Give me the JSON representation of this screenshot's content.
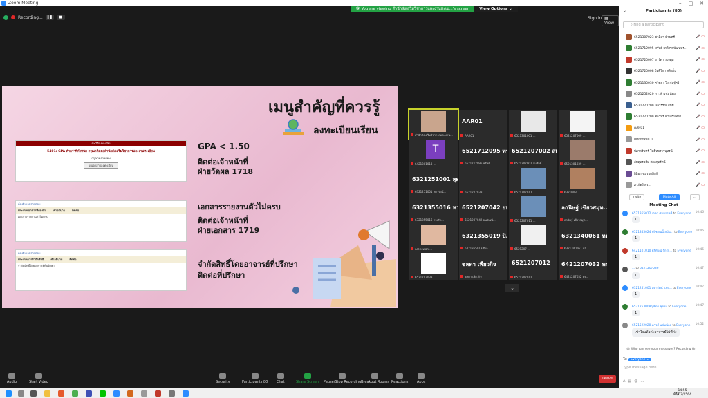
{
  "window": {
    "title": "Zoom Meeting"
  },
  "banner": {
    "message": "You are viewing สำนักส่งเสริมวิชาการและงานทะเบ...'s screen",
    "options": "View Options"
  },
  "recording": {
    "label": "Recording..."
  },
  "topright": {
    "signin": "Sign in",
    "view": "View"
  },
  "slide": {
    "title": "เมนูสำคัญที่ควรรู้",
    "subtitle": "ลงทะเบียนเรียน",
    "doc1": {
      "header": "ประวัติลงทะเบียน",
      "red": "5401: GPA ต่ำกว่าที่กำหนด กรุณาติดต่อสำนักส่งเสริมวิชาการและงานทะเบียน",
      "sub": "กรุณาตรวจสอบ",
      "btn": "ขอเอกสารลงทะเบียน"
    },
    "doc2": {
      "link": "ต้องยื่นเอกสารก่อน",
      "head1": "ประเภทเอกสารที่ต้องยื่น",
      "head2": "คำอธิบาย",
      "head3": "ติดต่อ",
      "row": "เอกสารรายงานตัวไม่ครบ"
    },
    "doc3": {
      "link": "ต้องยื่นเอกสารก่อน",
      "head1": "ประเภทการจำกัดสิทธิ์",
      "head2": "คำอธิบาย",
      "head3": "ติดต่อ",
      "row": "จำกัดสิทธิ์โดยอาจารย์ที่ปรึกษา"
    },
    "gpa": "GPA < 1.50",
    "c1a": "ติดต่อเจ้าหน้าที่",
    "c1b": "ฝ่ายวัดผล 1718",
    "c2a": "เอกสารรายงานตัวไม่ครบ",
    "c2b": "ติดต่อเจ้าหน้าที่",
    "c2c": "ฝ่ายเอกสาร 1719",
    "c3a": "จำกัดสิทธิ์โดยอาจารย์ที่ปรึกษา",
    "c3b": "ติดต่อที่ปรึกษา"
  },
  "gallery": [
    {
      "name": "",
      "cap": "สำนักส่งเสริมวิชาการและงาน..."
    },
    {
      "name": "AAR01",
      "cap": "AAR01"
    },
    {
      "name": "",
      "cap": "6521301001 ..."
    },
    {
      "name": "",
      "cap": "6521207009 ..."
    },
    {
      "name": "T",
      "cap": "6421301013 ..."
    },
    {
      "name": "6521712095 ทรั...",
      "cap": "6521712095 ทรัพย์..."
    },
    {
      "name": "6521207002 สม...",
      "cap": "6521207002 สมศักดิ์..."
    },
    {
      "name": "",
      "cap": "6521301039 ..."
    },
    {
      "name": "6321251001 สุด...",
      "cap": "6321251001 สุดารัตน์..."
    },
    {
      "name": "",
      "cap": "6521207038 ..."
    },
    {
      "name": "",
      "cap": "6521707017 ..."
    },
    {
      "name": "",
      "cap": "6321003 ..."
    },
    {
      "name": "6321355016 หว...",
      "cap": "6321355016 หวงรัก..."
    },
    {
      "name": "6521207042 ยน...",
      "cap": "6521207042 ยนวันเนี..."
    },
    {
      "name": "",
      "cap": "6521207011 ..."
    },
    {
      "name": "ลกนิษฐ์ เขียวสมุท...",
      "cap": "ลกนิษฐ์ เขียวสมุท..."
    },
    {
      "name": "",
      "cap": "Areeewan ..."
    },
    {
      "name": "6321355019 ปิ...",
      "cap": "6321355019 ปิยะ..."
    },
    {
      "name": "",
      "cap": "6521207 ..."
    },
    {
      "name": "6321340061 หนั...",
      "cap": "6321340061 หนั..."
    },
    {
      "name": "",
      "cap": "6521707033 ..."
    },
    {
      "name": "ชลดา เพียวกิจ",
      "cap": "ชลดา เพียวกิจ"
    },
    {
      "name": "6521207012",
      "cap": "6521207012"
    },
    {
      "name": "6421207032 พร...",
      "cap": "6421207032 พร..."
    }
  ],
  "toolbar": {
    "audio": "Audio",
    "video": "Start Video",
    "security": "Security",
    "participants": "Participants",
    "pcount": "80",
    "chat": "Chat",
    "share": "Share Screen",
    "record": "Pause/Stop Recording",
    "breakout": "Breakout Rooms",
    "reactions": "Reactions",
    "apps": "Apps",
    "leave": "Leave"
  },
  "panel": {
    "title": "Participants (80)",
    "search": "Find a participant",
    "invite": "Invite",
    "muteall": "Mute All",
    "more": "...",
    "items": [
      {
        "n": "6521307023 ชาลิสา ม้วนศรี",
        "c": "#a0522d"
      },
      {
        "n": "6521712095 ทรัพย์ เคลิงรศพัฒนพร...",
        "c": "#2e7d32"
      },
      {
        "n": "6521720007 อาร์ดา รวงคูล",
        "c": "#c0392b"
      },
      {
        "n": "6521720008 วิลศิริกา สลิงมั่น",
        "c": "#333"
      },
      {
        "n": "6521130030 ศรีดลา วิรเชษฐ์ศรี",
        "c": "#2e7d32"
      },
      {
        "n": "6521252020 ภาวดี แช่มน้อย",
        "c": "#888"
      },
      {
        "n": "6521720209 นิลวรรณ สินมี",
        "c": "#3a5f8f"
      },
      {
        "n": "6521720209 ศิลาพร ด่าเสริมทอง",
        "c": "#2e7d32"
      },
      {
        "n": "AAR01",
        "c": "#f39c12"
      },
      {
        "n": "Areeewan n.",
        "c": "#999"
      },
      {
        "n": "ปภาวรินทร์ โพธิ์ทองจาบุทรน์",
        "c": "#c0392b"
      },
      {
        "n": "อับดุลรอฮีม สกลกุลรัตน์",
        "c": "#555"
      },
      {
        "n": "อิลิยา ชมรอดสิงห์",
        "c": "#6a4c93"
      },
      {
        "n": "ภรภัทร์ สร...",
        "c": "#999"
      }
    ],
    "chat_title": "Meeting Chat",
    "messages": [
      {
        "from": "6521355012 เฉลา ศนมรรคที่",
        "to": "Everyone",
        "t": "10:46",
        "msg": "1",
        "c": "#2d8cff"
      },
      {
        "from": "6521355024 ปรีชาณฉั้ สมัน...",
        "to": "Everyone",
        "t": "10:46",
        "msg": "1",
        "c": "#2e7d32"
      },
      {
        "from": "6421101010 ยูลิทัยณ์ รักรัก...",
        "to": "Everyone",
        "t": "10:46",
        "msg": "1",
        "c": "#c0392b"
      },
      {
        "from": "...",
        "to": "6421207036",
        "t": "10:47",
        "msg": "1",
        "c": "#555"
      },
      {
        "from": "6321251001 สุดารัตน์ แปร...",
        "to": "Everyone",
        "t": "10:47",
        "msg": "1",
        "c": "#2d8cff"
      },
      {
        "from": "6521253008ญชิตา ชุดงม",
        "to": "Everyone",
        "t": "10:47",
        "msg": "1",
        "c": "#2e7d32"
      },
      {
        "from": "6521522020 ภาวดี แช่มน้อย",
        "to": "Everyone",
        "t": "10:52",
        "msg": "เข้าใจแล้วค่ะอาจารย์ไม่พี่ค่ะ",
        "c": "#888"
      }
    ],
    "whocan": "Who can see your messages? Recording On",
    "to_label": "To:",
    "everyone": "Everyone",
    "placeholder": "Type message here..."
  },
  "taskbar": {
    "time": "14:55",
    "date": "05/07/2564",
    "lang": "ไทย"
  }
}
